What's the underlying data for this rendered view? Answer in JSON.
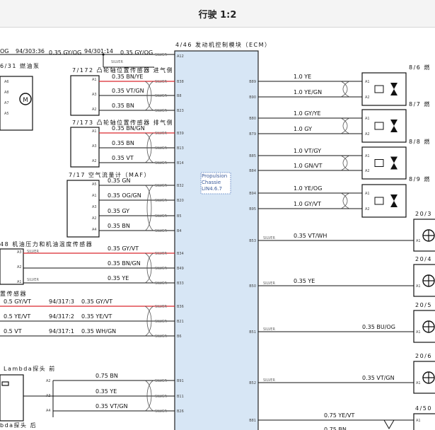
{
  "header": {
    "title": "行驶 1:2"
  },
  "ecm": {
    "title": "4/46 发动机控制模块（ECM）",
    "propulsion": [
      "Propulsion",
      "Chassie",
      "LIN4.6.7"
    ],
    "pins_left": [
      "A12",
      "B38",
      "B8",
      "B23",
      "B39",
      "B13",
      "B14",
      "B32",
      "B20",
      "B5",
      "B4",
      "B34",
      "B49",
      "B33",
      "B36",
      "B21",
      "B6",
      "B91",
      "B11",
      "B26"
    ],
    "pins_right": [
      "B89",
      "B90",
      "B80",
      "B79",
      "B85",
      "B84",
      "B94",
      "B95",
      "B53",
      "B50",
      "B51",
      "B52",
      "B81"
    ]
  },
  "left_labels": {
    "fuel_pump": "6/31 燃油泵",
    "cam_intake": "7/172 凸轮轴位置传感器 进气侧",
    "cam_exhaust": "7/173 凸轮轴位置传感器 排气侧",
    "maf": "7/17 空气流量计（MAF）",
    "oil_sensor": "48 机油压力和机油温度传感器",
    "pos_sensor": "置传感器",
    "lambda_front": "Lambda探头 前",
    "lambda_rear": "bda探头 后",
    "top_wire_a": "OG",
    "top_splice_a": "94/303:36",
    "top_wire_b": "0.35 GY/OG",
    "top_splice_b": "94/301:14",
    "top_wire_c": "0.35 GY/OG",
    "silver": "SILVER"
  },
  "left_wires": [
    "0.35 BN/YE",
    "0.35 VT/GN",
    "0.35 BN",
    "0.35 BN/GN",
    "0.35 BN",
    "0.35 VT",
    "0.35 GN",
    "0.35 OG/GN",
    "0.35 GY",
    "0.35 BN",
    "0.35 GY/VT",
    "0.35 BN/GN",
    "0.35 YE",
    "0.35 GY/VT",
    "0.35 YE/VT",
    "0.35 WH/GN",
    "0.75 BN",
    "0.35 YE",
    "0.35 VT/GN"
  ],
  "pos_sensor_wires": [
    "0.5 GY/VT",
    "0.5 YE/VT",
    "0.5 VT"
  ],
  "pos_sensor_splices": [
    "94/317:3",
    "94/317:2",
    "94/317:1"
  ],
  "right_wires": [
    "1.0 YE",
    "1.0 YE/GN",
    "1.0 GY/YE",
    "1.0 GY",
    "1.0 VT/GY",
    "1.0 GN/VT",
    "1.0 YE/OG",
    "1.0 GY/VT"
  ],
  "right_lower_wires": [
    "0.35 VT/WH",
    "0.35 YE",
    "0.35 BU/OG",
    "0.35 VT/GN",
    "0.75 YE/VT"
  ],
  "injectors": [
    "8/6 燃",
    "8/7 燃",
    "8/8 燃",
    "8/9 燃"
  ],
  "coils": [
    "20/3",
    "20/4",
    "20/5",
    "20/6",
    "4/50"
  ]
}
